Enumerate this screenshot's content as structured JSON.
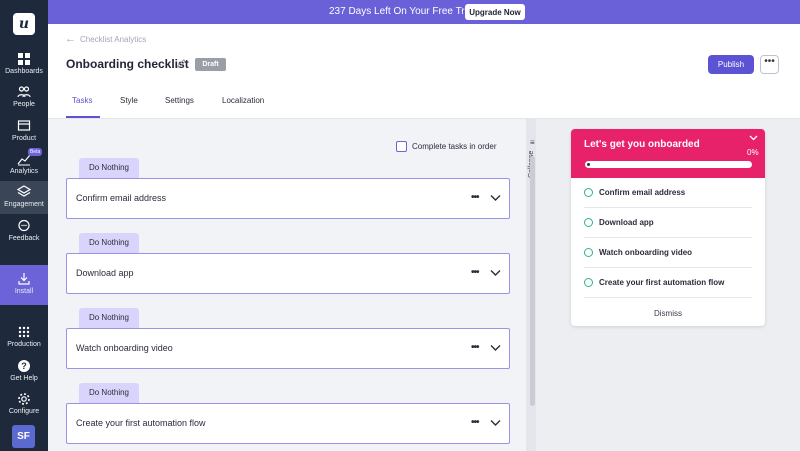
{
  "sidebar": {
    "logo": "u",
    "items": [
      {
        "label": "Dashboards",
        "icon": "grid-icon"
      },
      {
        "label": "People",
        "icon": "people-icon"
      },
      {
        "label": "Product",
        "icon": "product-icon"
      },
      {
        "label": "Analytics",
        "icon": "analytics-icon",
        "badge": "Beta"
      },
      {
        "label": "Engagement",
        "icon": "layers-icon"
      },
      {
        "label": "Feedback",
        "icon": "chat-icon"
      },
      {
        "label": "Install",
        "icon": "download-icon"
      },
      {
        "label": "Production",
        "icon": "apps-icon"
      },
      {
        "label": "Get Help",
        "icon": "help-icon"
      },
      {
        "label": "Configure",
        "icon": "gear-icon"
      }
    ],
    "avatar": "SF"
  },
  "banner": {
    "text": "237 Days Left On Your Free Trial",
    "upgrade_label": "Upgrade Now"
  },
  "header": {
    "breadcrumb": "Checklist Analytics",
    "title": "Onboarding checklist",
    "status": "Draft",
    "publish_label": "Publish",
    "more_label": "•••"
  },
  "tabs": [
    {
      "label": "Tasks",
      "active": true
    },
    {
      "label": "Style"
    },
    {
      "label": "Settings"
    },
    {
      "label": "Localization"
    }
  ],
  "tasks_panel": {
    "complete_in_order_label": "Complete tasks in order",
    "complete_in_order_checked": false,
    "action_label": "Do Nothing",
    "tasks": [
      {
        "title": "Confirm email address",
        "action": "Do Nothing"
      },
      {
        "title": "Download app",
        "action": "Do Nothing"
      },
      {
        "title": "Watch onboarding video",
        "action": "Do Nothing"
      },
      {
        "title": "Create your first automation flow",
        "action": "Do Nothing"
      }
    ],
    "dots": "•••",
    "collapse_label": "Collapse"
  },
  "preview": {
    "title": "Let's get you onboarded",
    "progress_text": "0%",
    "progress": 0,
    "items": [
      "Confirm email address",
      "Download app",
      "Watch onboarding video",
      "Create your first automation flow"
    ],
    "dismiss_label": "Dismiss"
  },
  "colors": {
    "sidebar": "#1e2a3c",
    "accent": "#5c52d4",
    "banner": "#6a61d9",
    "widget_header": "#e8226a",
    "task_tag": "#d9d4fb",
    "check_circle": "#2fb58a"
  }
}
